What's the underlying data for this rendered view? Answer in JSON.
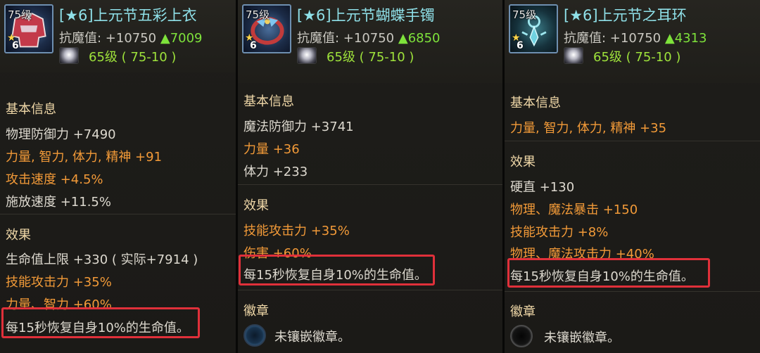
{
  "tooltips": [
    {
      "level": "75级",
      "star": "★",
      "plus": "6",
      "title": "[★6]上元节五彩上衣",
      "resist_label": "抗魔值: +10750 ",
      "resist_delta": "▲7009",
      "level_req": "65级 ( 75-10 )",
      "basic_header": "基本信息",
      "basic": [
        {
          "text": "物理防御力 +7490",
          "color": "white"
        },
        {
          "text": "力量, 智力, 体力, 精神 +91",
          "color": "orange"
        },
        {
          "text": "攻击速度 +4.5%",
          "color": "orange"
        },
        {
          "text": "施放速度 +11.5%",
          "color": "white"
        }
      ],
      "effects_header": "效果",
      "effects": [
        {
          "text": "生命值上限 +330 ( 实际+7914 )",
          "color": "white"
        },
        {
          "text": "技能攻击力 +35%",
          "color": "orange"
        },
        {
          "text": "力量、智力 +60%",
          "color": "orange"
        }
      ],
      "highlight_text": "每15秒恢复自身10%的生命值。"
    },
    {
      "level": "75级",
      "star": "★",
      "plus": "6",
      "title": "[★6]上元节蝴蝶手镯",
      "resist_label": "抗魔值: +10750 ",
      "resist_delta": "▲6850",
      "level_req": "65级 ( 75-10 )",
      "basic_header": "基本信息",
      "basic": [
        {
          "text": "魔法防御力 +3741",
          "color": "white"
        },
        {
          "text": "力量 +36",
          "color": "orange"
        },
        {
          "text": "体力 +233",
          "color": "white"
        }
      ],
      "effects_header": "效果",
      "effects": [
        {
          "text": "技能攻击力 +35%",
          "color": "orange"
        },
        {
          "text": "伤害 +60%",
          "color": "orange"
        }
      ],
      "highlight_text": "每15秒恢复自身10%的生命值。",
      "badge_header": "徽章",
      "badge_text": "未镶嵌徽章。"
    },
    {
      "level": "75级",
      "star": "★",
      "plus": "6",
      "title": "[★6]上元节之耳环",
      "resist_label": "抗魔值: +10750 ",
      "resist_delta": "▲4313",
      "level_req": "65级 ( 75-10 )",
      "basic_header": "基本信息",
      "basic": [
        {
          "text": "力量, 智力, 体力, 精神 +35",
          "color": "orange"
        }
      ],
      "effects_header": "效果",
      "effects": [
        {
          "text": "硬直 +130",
          "color": "white"
        },
        {
          "text": "物理、魔法暴击 +150",
          "color": "orange"
        },
        {
          "text": "技能攻击力 +8%",
          "color": "orange"
        },
        {
          "text": "物理、魔法攻击力 +40%",
          "color": "orange"
        }
      ],
      "highlight_text": "每15秒恢复自身10%的生命值。",
      "badge_header": "徽章",
      "badge_text": "未镶嵌徽章。"
    }
  ],
  "colors": {
    "title": "#8fe0e8",
    "orange": "#f29a38",
    "delta": "#7ee23b",
    "highlight_box": "#e0303a"
  },
  "icons": [
    "armor-top-icon",
    "bracelet-icon",
    "earring-icon",
    "gem-icon",
    "badge-socket-icon"
  ]
}
